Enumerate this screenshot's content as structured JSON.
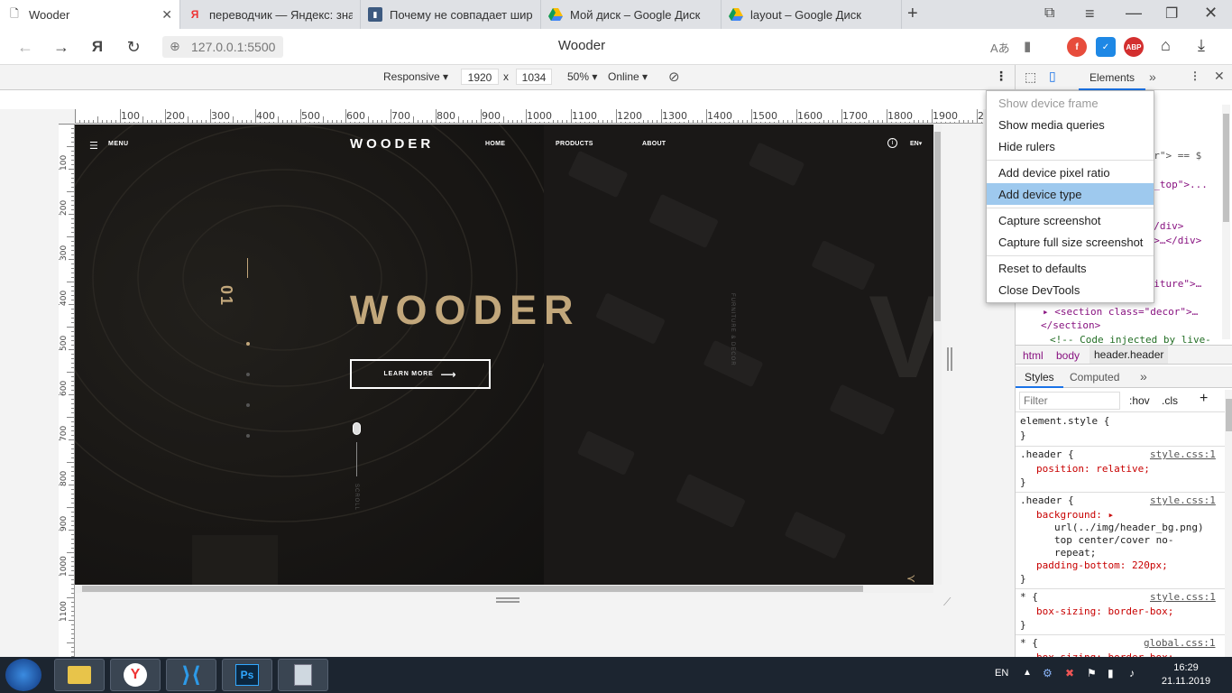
{
  "tabs": [
    {
      "label": "Wooder",
      "icon": "page-icon",
      "active": true
    },
    {
      "label": "переводчик — Яндекс: зна",
      "icon": "yandex-icon"
    },
    {
      "label": "Почему не совпадает шир",
      "icon": "stackoverflow-icon"
    },
    {
      "label": "Мой диск – Google Диск",
      "icon": "google-drive-icon"
    },
    {
      "label": "layout – Google Диск",
      "icon": "google-drive-icon"
    }
  ],
  "address": {
    "url": "127.0.0.1:5500",
    "page_title": "Wooder"
  },
  "devbar": {
    "mode": "Responsive",
    "width": "1920",
    "times": "x",
    "height": "1034",
    "zoom": "50%",
    "network": "Online"
  },
  "ruler": {
    "top": [
      "100",
      "200",
      "300",
      "400",
      "500",
      "600",
      "700",
      "800",
      "900",
      "1000",
      "1100",
      "1200",
      "1300",
      "1400",
      "1500",
      "1600",
      "1700",
      "1800",
      "1900",
      "20"
    ],
    "left": [
      "100",
      "200",
      "300",
      "400",
      "500",
      "600",
      "700",
      "800",
      "900",
      "1000",
      "1100"
    ]
  },
  "site": {
    "menu_label": "MENU",
    "logo": "WOODER",
    "nav": [
      "HOME",
      "PRODUCTS",
      "ABOUT"
    ],
    "lang": "EN",
    "hero_title": "WOODER",
    "button": "LEARN MORE",
    "slide_number": "01",
    "vertical_text": "FURNITURE & DECOR",
    "scroll_label": "SCROLL"
  },
  "devtools": {
    "tab_elements": "Elements",
    "code_lines": [
      {
        "text": "der\"> == $"
      },
      {
        "text": "er_top\">..."
      },
      {
        "text": "…</div>"
      },
      {
        "text": "e\">…</div>"
      },
      {
        "text": "rniture\">…"
      },
      {
        "text": "<section class=\"decor\">…"
      },
      {
        "text": "</section>"
      },
      {
        "text": "<!-- Code injected by live-"
      }
    ],
    "breadcrumbs": [
      "html",
      "body",
      "header.header"
    ],
    "styles_tab": "Styles",
    "computed_tab": "Computed",
    "filter_placeholder": "Filter",
    "hov": ":hov",
    "cls": ".cls",
    "rules": [
      {
        "selector": "element.style {",
        "source": "",
        "decls": [],
        "close": "}"
      },
      {
        "selector": ".header {",
        "source": "style.css:1",
        "decls": [
          "position: relative;"
        ],
        "close": "}"
      },
      {
        "selector": ".header {",
        "source": "style.css:1",
        "decls": [
          "background: ▸",
          "url(../img/header_bg.png)",
          "top center/cover no-",
          "repeat;",
          "padding-bottom: 220px;"
        ],
        "close": "}"
      },
      {
        "selector": "* {",
        "source": "style.css:1",
        "decls": [
          "box-sizing: border-box;"
        ],
        "close": "}"
      },
      {
        "selector": "* {",
        "source": "global.css:1",
        "decls": [
          "box-sizing: border-box;"
        ],
        "close": ""
      }
    ]
  },
  "menu": {
    "items": [
      {
        "label": "Show device frame",
        "disabled": true
      },
      {
        "label": "Show media queries"
      },
      {
        "label": "Hide rulers"
      },
      {
        "label": "Add device pixel ratio"
      },
      {
        "label": "Add device type",
        "highlighted": true
      },
      {
        "label": "Capture screenshot"
      },
      {
        "label": "Capture full size screenshot"
      },
      {
        "label": "Reset to defaults"
      },
      {
        "label": "Close DevTools"
      }
    ]
  },
  "taskbar": {
    "lang": "EN",
    "time": "16:29",
    "date": "21.11.2019",
    "apps": [
      "file-explorer-icon",
      "yandex-browser-icon",
      "vscode-icon",
      "photoshop-icon",
      "calculator-icon"
    ]
  }
}
